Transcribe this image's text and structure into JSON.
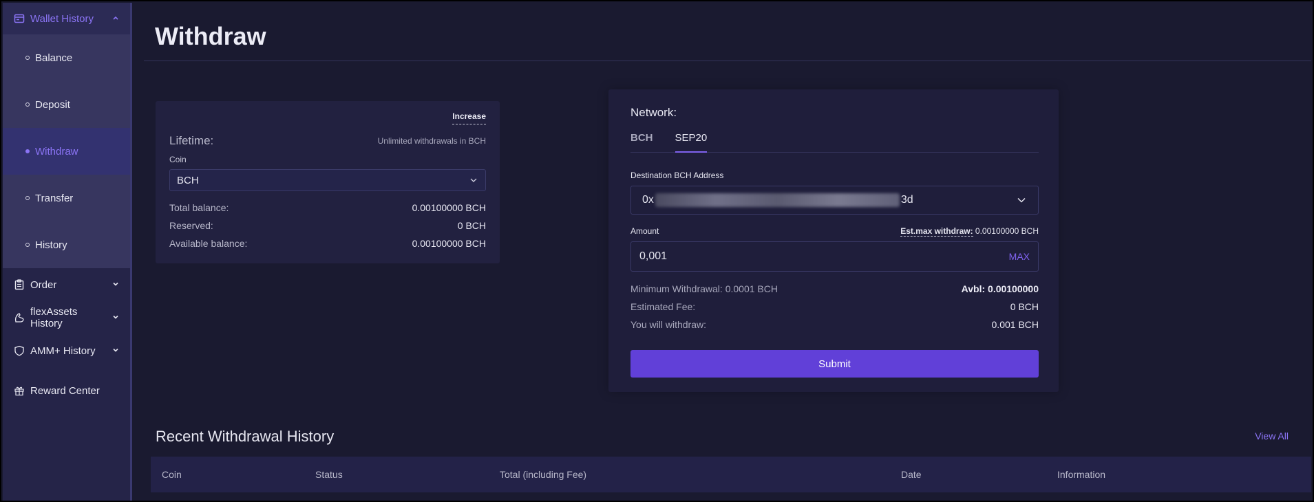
{
  "sidebar": {
    "wallet_history": "Wallet History",
    "sub_items": [
      "Balance",
      "Deposit",
      "Withdraw",
      "Transfer",
      "History"
    ],
    "active_sub": "Withdraw",
    "order": "Order",
    "flexassets": "flexAssets History",
    "amm": "AMM+ History",
    "reward": "Reward Center"
  },
  "page": {
    "title": "Withdraw"
  },
  "left_card": {
    "increase": "Increase",
    "lifetime": "Lifetime:",
    "unlimited": "Unlimited withdrawals in BCH",
    "coin_label": "Coin",
    "coin_value": "BCH",
    "total_label": "Total balance:",
    "total_value": "0.00100000 BCH",
    "reserved_label": "Reserved:",
    "reserved_value": "0 BCH",
    "available_label": "Available balance:",
    "available_value": "0.00100000 BCH"
  },
  "right_card": {
    "network_label": "Network:",
    "tabs": [
      "BCH",
      "SEP20"
    ],
    "active_tab": "SEP20",
    "dest_label": "Destination BCH Address",
    "dest_prefix": "0x",
    "dest_suffix": "3d",
    "amount_label": "Amount",
    "est_max_label": "Est.max withdraw:",
    "est_max_value": "0.00100000 BCH",
    "amount_value": "0,001",
    "max_label": "MAX",
    "min_withdraw": "Minimum Withdrawal: 0.0001 BCH",
    "avbl": "Avbl: 0.00100000",
    "fee_label": "Estimated Fee:",
    "fee_value": "0 BCH",
    "withdraw_label": "You will withdraw:",
    "withdraw_value": "0.001 BCH",
    "submit": "Submit"
  },
  "history": {
    "title": "Recent Withdrawal History",
    "view_all": "View All",
    "columns": [
      "Coin",
      "Status",
      "Total (including Fee)",
      "Date",
      "Information"
    ]
  },
  "colors": {
    "accent": "#7f62ee",
    "button": "#6140d8",
    "background": "#1a1a30",
    "sidebar": "#252448"
  }
}
